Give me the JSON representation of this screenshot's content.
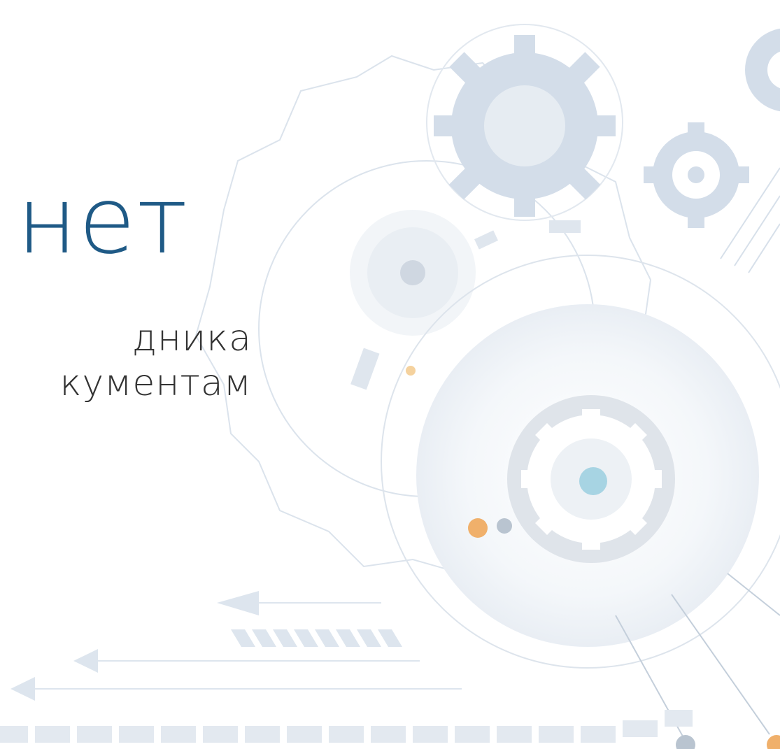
{
  "slide": {
    "title": "нет",
    "subtitle_lines": [
      "дника",
      "кументам"
    ]
  },
  "colors": {
    "title": "#1f5a86",
    "subtitle": "#333333",
    "gear_light": "#e7edf4",
    "gear_mid": "#d3dde9",
    "gear_outline": "#dbe3ec",
    "accent_orange": "#f0b06b",
    "accent_blue": "#a7d4e3",
    "accent_grey": "#b9c4d0"
  },
  "icons": [
    "gear-icon",
    "arrow-left-icon",
    "dot-icon"
  ]
}
